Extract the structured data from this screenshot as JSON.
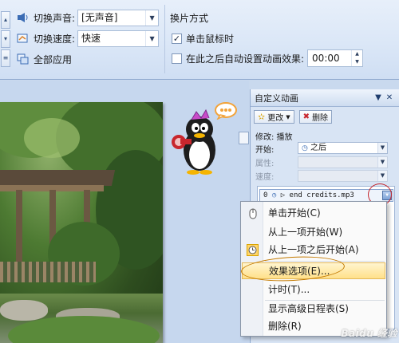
{
  "ribbon": {
    "sound_label": "切换声音:",
    "sound_value": "[无声音]",
    "speed_label": "切换速度:",
    "speed_value": "快速",
    "apply_all_label": "全部应用",
    "group_caption": "换片方式",
    "on_click_label": "单击鼠标时",
    "on_click_checked": true,
    "auto_after_label": "在此之后自动设置动画效果:",
    "auto_after_checked": false,
    "auto_after_time": "00:00"
  },
  "pane": {
    "title": "自定义动画",
    "change_button": "更改",
    "delete_button": "删除",
    "modify_line": "修改: 播放",
    "start_label": "开始:",
    "start_value": "之后",
    "property_label": "属性:",
    "speed_label": "速度:",
    "item_index": "0",
    "item_name": "end credits.mp3"
  },
  "context_menu": {
    "items": [
      {
        "label": "单击开始(C)",
        "icon": "mouse-icon"
      },
      {
        "label": "从上一项开始(W)",
        "icon": ""
      },
      {
        "label": "从上一项之后开始(A)",
        "icon": "clock-icon",
        "checked": true
      },
      {
        "label": "效果选项(E)...",
        "icon": "",
        "highlighted": true
      },
      {
        "label": "计时(T)...",
        "icon": ""
      },
      {
        "label": "显示高级日程表(S)",
        "icon": ""
      },
      {
        "label": "删除(R)",
        "icon": ""
      }
    ]
  },
  "watermark": "Baidu 经验"
}
